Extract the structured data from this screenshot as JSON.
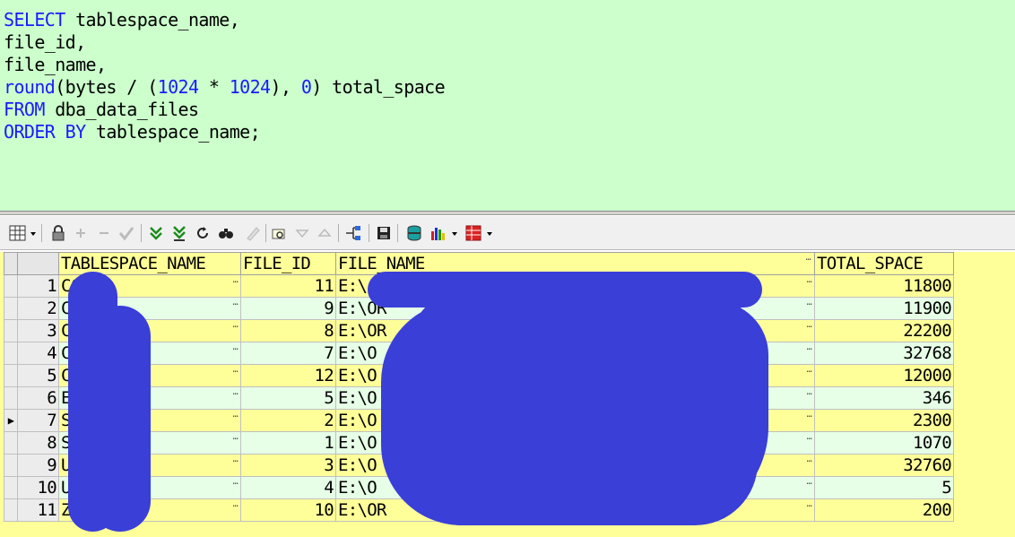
{
  "editor": {
    "lines": [
      [
        {
          "t": "SELECT",
          "k": true
        },
        {
          "t": " tablespace_name,"
        }
      ],
      [
        {
          "t": "file_id,"
        }
      ],
      [
        {
          "t": "file_name,"
        }
      ],
      [
        {
          "t": "round",
          "k": true
        },
        {
          "t": "(bytes / ("
        },
        {
          "t": "1024",
          "k": true
        },
        {
          "t": " * "
        },
        {
          "t": "1024",
          "k": true
        },
        {
          "t": "), "
        },
        {
          "t": "0",
          "k": true
        },
        {
          "t": ") total_space"
        }
      ],
      [
        {
          "t": "FROM",
          "k": true
        },
        {
          "t": " dba_data_files"
        }
      ],
      [
        {
          "t": "ORDER BY",
          "k": true
        },
        {
          "t": " tablespace_name;"
        }
      ]
    ]
  },
  "toolbar": {
    "icons": [
      "grid-menu-icon",
      "lock-icon",
      "add-record-icon",
      "delete-record-icon",
      "post-edit-icon",
      "fetch-next-icon",
      "fetch-last-icon",
      "refresh-icon",
      "find-icon",
      "clear-icon",
      "query-by-example-icon",
      "filter-down-icon",
      "filter-up-icon",
      "export-icon",
      "save-icon",
      "db-icon",
      "chart-icon",
      "table-view-icon"
    ]
  },
  "grid": {
    "columns": [
      "TABLESPACE_NAME",
      "FILE_ID",
      "FILE_NAME",
      "TOTAL_SPACE"
    ],
    "current_row": 7,
    "rows": [
      {
        "no": "1",
        "name": "CCP",
        "file_id": "11",
        "file_name": "E:\\",
        "total": "11800"
      },
      {
        "no": "2",
        "name": "C",
        "file_id": "9",
        "file_name": "E:\\OR",
        "total": "11900"
      },
      {
        "no": "3",
        "name": "C",
        "file_id": "8",
        "file_name": "E:\\OR",
        "total": "22200"
      },
      {
        "no": "4",
        "name": "C",
        "file_id": "7",
        "file_name": "E:\\O",
        "total": "32768"
      },
      {
        "no": "5",
        "name": "C",
        "file_id": "12",
        "file_name": "E:\\O",
        "total": "12000"
      },
      {
        "no": "6",
        "name": "E",
        "file_id": "5",
        "file_name": "E:\\O",
        "total": "346"
      },
      {
        "no": "7",
        "name": "S",
        "file_id": "2",
        "file_name": "E:\\O",
        "total": "2300"
      },
      {
        "no": "8",
        "name": "S",
        "file_id": "1",
        "file_name": "E:\\O",
        "total": "1070"
      },
      {
        "no": "9",
        "name": "U",
        "file_id": "3",
        "file_name": "E:\\O",
        "total": "32760"
      },
      {
        "no": "10",
        "name": "U",
        "file_id": "4",
        "file_name": "E:\\O",
        "total": "5"
      },
      {
        "no": "11",
        "name": "Z",
        "file_id": "10",
        "file_name": "E:\\OR",
        "total": "200"
      }
    ]
  },
  "colors": {
    "editor_bg": "#ccffcc",
    "keyword": "#1a1aff",
    "row_odd": "#ffff99",
    "row_even": "#e6ffe6",
    "redaction": "#3a3fd8"
  }
}
